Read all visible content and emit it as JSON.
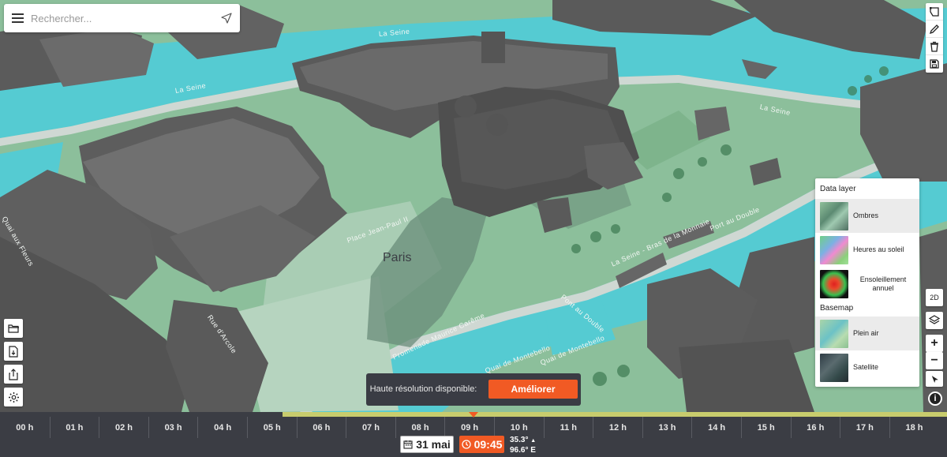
{
  "search": {
    "placeholder": "Rechercher..."
  },
  "map": {
    "city_label": "Paris",
    "street_labels": [
      "La Seine",
      "La Seine",
      "La Seine",
      "La Seine - Bras de la Monnaie",
      "Quai de Montebello",
      "Quai de Montebello",
      "Port au Double",
      "Pont au Double",
      "Promenade Maurice Carême",
      "Place Jean-Paul II",
      "Rue d'Arcole",
      "Quai aux Fleurs"
    ]
  },
  "layers": {
    "data_title": "Data layer",
    "data_items": [
      {
        "label": "Ombres",
        "active": true
      },
      {
        "label": "Heures au soleil",
        "active": false
      },
      {
        "label": "Ensoleillement annuel",
        "active": false
      }
    ],
    "basemap_title": "Basemap",
    "basemap_items": [
      {
        "label": "Plein air",
        "active": true
      },
      {
        "label": "Satellite",
        "active": false
      }
    ]
  },
  "controls": {
    "mode_2d": "2D",
    "zoom_in": "+",
    "zoom_out": "−",
    "info": "i"
  },
  "banner": {
    "text": "Haute résolution disponible:",
    "button": "Améliorer"
  },
  "timeline": {
    "hours": [
      "00 h",
      "01 h",
      "02 h",
      "03 h",
      "04 h",
      "05 h",
      "06 h",
      "07 h",
      "08 h",
      "09 h",
      "10 h",
      "11 h",
      "12 h",
      "13 h",
      "14 h",
      "15 h",
      "16 h",
      "17 h",
      "18 h"
    ],
    "date": "31 mai",
    "time": "09:45",
    "elevation": "35.3°",
    "azimuth": "96.6° E"
  },
  "colors": {
    "accent": "#f15a24",
    "water": "#4cc8d3",
    "park": "#8fbe9e",
    "building": "#5c5c5c",
    "timeline_bg": "#3b3d44",
    "sun_bar": "#c8cc6d"
  }
}
